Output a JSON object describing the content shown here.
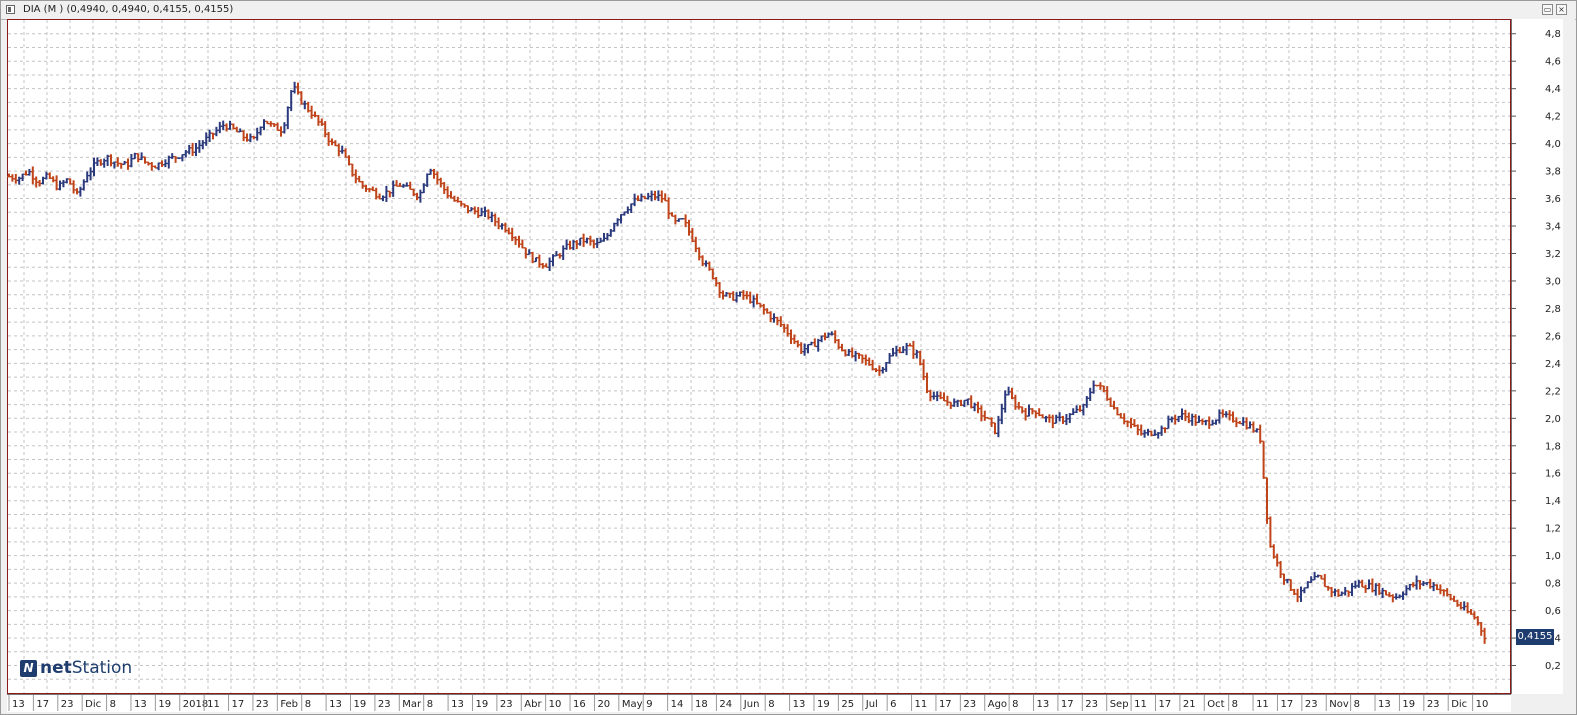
{
  "window": {
    "title": "DIA (M ) (0,4940, 0,4940, 0,4155, 0,4155)",
    "restore_glyph": "▭",
    "close_glyph": "×"
  },
  "logo": {
    "mark": "N",
    "brand_net": "net",
    "brand_station": "Station"
  },
  "last_price_label": "0,4155",
  "colors": {
    "up": "#2b3a7d",
    "down": "#c0441a",
    "grid": "#c4c4c4",
    "frame": "#8b1a1a",
    "price_tag": "#1e3d6e"
  },
  "chart_data": {
    "type": "ohlc",
    "grid": true,
    "ylim": [
      0.0,
      4.9
    ],
    "yticks": [
      "4,8",
      "4,6",
      "4,4",
      "4,2",
      "4,0",
      "3,8",
      "3,6",
      "3,4",
      "3,2",
      "3,0",
      "2,8",
      "2,6",
      "2,4",
      "2,2",
      "2,0",
      "1,8",
      "1,6",
      "1,4",
      "1,2",
      "1,0",
      "0,8",
      "0,6",
      "0,4",
      "0,2"
    ],
    "ytick_values": [
      4.8,
      4.6,
      4.4,
      4.2,
      4.0,
      3.8,
      3.6,
      3.4,
      3.2,
      3.0,
      2.8,
      2.6,
      2.4,
      2.2,
      2.0,
      1.8,
      1.6,
      1.4,
      1.2,
      1.0,
      0.8,
      0.6,
      0.4,
      0.2
    ],
    "xticks": [
      "13",
      "17",
      "23",
      "Dic",
      "8",
      "13",
      "19",
      "2018",
      "11",
      "17",
      "23",
      "Feb",
      "8",
      "13",
      "19",
      "23",
      "Mar",
      "8",
      "13",
      "19",
      "23",
      "Abr",
      "10",
      "16",
      "20",
      "May",
      "9",
      "14",
      "18",
      "24",
      "Jun",
      "8",
      "13",
      "19",
      "25",
      "Jul",
      "6",
      "11",
      "17",
      "23",
      "Ago",
      "8",
      "13",
      "17",
      "23",
      "Sep",
      "11",
      "17",
      "21",
      "Oct",
      "8",
      "11",
      "17",
      "23",
      "Nov",
      "8",
      "13",
      "19",
      "23",
      "Dic",
      "10"
    ],
    "close_path": [
      3.76,
      3.75,
      3.8,
      3.72,
      3.76,
      3.68,
      3.74,
      3.62,
      3.78,
      3.86,
      3.9,
      3.86,
      3.84,
      3.92,
      3.86,
      3.84,
      3.88,
      3.9,
      3.94,
      3.96,
      4.02,
      4.08,
      4.14,
      4.1,
      4.05,
      4.02,
      4.18,
      4.12,
      4.1,
      4.42,
      4.3,
      4.22,
      4.12,
      4.0,
      3.95,
      3.8,
      3.7,
      3.66,
      3.62,
      3.66,
      3.7,
      3.66,
      3.62,
      3.84,
      3.72,
      3.62,
      3.56,
      3.52,
      3.5,
      3.48,
      3.42,
      3.38,
      3.3,
      3.2,
      3.14,
      3.12,
      3.18,
      3.24,
      3.28,
      3.3,
      3.26,
      3.3,
      3.44,
      3.52,
      3.58,
      3.6,
      3.62,
      3.6,
      3.42,
      3.44,
      3.3,
      3.14,
      3.04,
      2.9,
      2.88,
      2.9,
      2.86,
      2.8,
      2.74,
      2.68,
      2.6,
      2.5,
      2.52,
      2.58,
      2.62,
      2.52,
      2.46,
      2.44,
      2.4,
      2.34,
      2.44,
      2.5,
      2.52,
      2.46,
      2.2,
      2.14,
      2.12,
      2.1,
      2.14,
      2.06,
      2.0,
      1.9,
      2.2,
      2.1,
      2.04,
      2.06,
      2.0,
      1.98,
      2.0,
      2.04,
      2.08,
      2.26,
      2.2,
      2.08,
      2.0,
      1.94,
      1.88,
      1.9,
      1.92,
      2.0,
      2.02,
      2.0,
      1.96,
      1.98,
      2.02,
      2.0,
      1.98,
      1.94,
      1.88,
      1.08,
      0.9,
      0.78,
      0.7,
      0.8,
      0.84,
      0.76,
      0.72,
      0.74,
      0.8,
      0.78,
      0.76,
      0.72,
      0.7,
      0.76,
      0.8,
      0.8,
      0.78,
      0.72,
      0.66,
      0.6,
      0.55,
      0.4155
    ]
  }
}
